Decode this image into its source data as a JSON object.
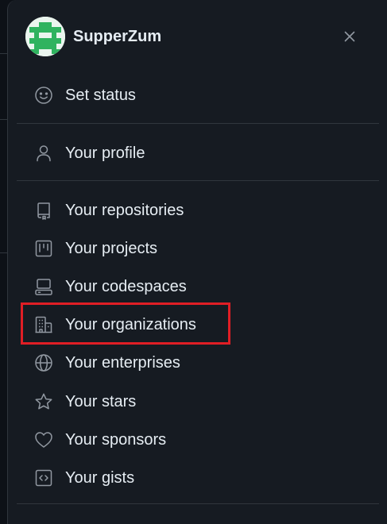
{
  "user": {
    "username": "SupperZum"
  },
  "menu": {
    "status": {
      "label": "Set status",
      "icon": "smiley-icon"
    },
    "profile": {
      "label": "Your profile",
      "icon": "person-icon"
    },
    "items": [
      {
        "label": "Your repositories",
        "icon": "repo-icon"
      },
      {
        "label": "Your projects",
        "icon": "project-icon"
      },
      {
        "label": "Your codespaces",
        "icon": "codespaces-icon"
      },
      {
        "label": "Your organizations",
        "icon": "organization-icon"
      },
      {
        "label": "Your enterprises",
        "icon": "globe-icon"
      },
      {
        "label": "Your stars",
        "icon": "star-icon"
      },
      {
        "label": "Your sponsors",
        "icon": "heart-icon"
      },
      {
        "label": "Your gists",
        "icon": "code-square-icon"
      }
    ]
  },
  "colors": {
    "panel_bg": "#161b22",
    "text": "#e6edf3",
    "icon": "#9198a1",
    "divider": "#30363d",
    "highlight": "#e01e25",
    "avatar_green": "#2fb35f"
  }
}
